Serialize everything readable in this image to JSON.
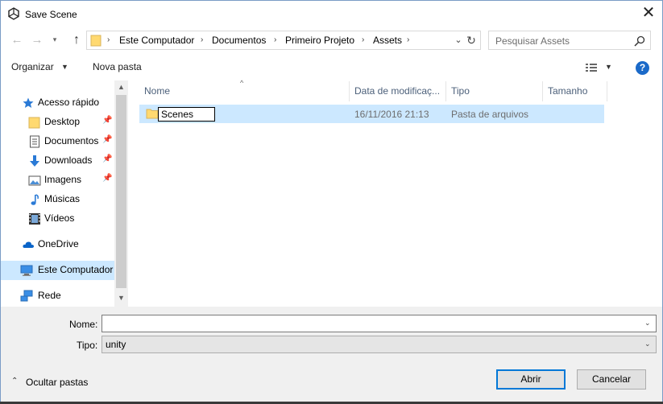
{
  "window": {
    "title": "Save Scene"
  },
  "address": {
    "breadcrumbs": [
      "Este Computador",
      "Documentos",
      "Primeiro Projeto",
      "Assets"
    ],
    "search_placeholder": "Pesquisar Assets"
  },
  "toolbar": {
    "organize_label": "Organizar",
    "new_folder_label": "Nova pasta"
  },
  "sidebar": {
    "items": [
      {
        "label": "Acesso rápido",
        "icon": "star-icon"
      },
      {
        "label": "Desktop",
        "icon": "folder-icon",
        "pinned": true
      },
      {
        "label": "Documentos",
        "icon": "document-icon",
        "pinned": true
      },
      {
        "label": "Downloads",
        "icon": "download-icon",
        "pinned": true
      },
      {
        "label": "Imagens",
        "icon": "image-icon",
        "pinned": true
      },
      {
        "label": "Músicas",
        "icon": "music-icon"
      },
      {
        "label": "Vídeos",
        "icon": "video-icon"
      },
      {
        "label": "OneDrive",
        "icon": "cloud-icon"
      },
      {
        "label": "Este Computador",
        "icon": "computer-icon",
        "selected": true
      },
      {
        "label": "Rede",
        "icon": "network-icon"
      }
    ]
  },
  "columns": [
    "Nome",
    "Data de modificaç...",
    "Tipo",
    "Tamanho"
  ],
  "files": [
    {
      "name": "Scenes",
      "modified": "16/11/2016 21:13",
      "type": "Pasta de arquivos",
      "size": ""
    }
  ],
  "form": {
    "name_label": "Nome:",
    "name_value": "",
    "type_label": "Tipo:",
    "type_value": "unity"
  },
  "footer": {
    "hide_folders_label": "Ocultar pastas",
    "open_label": "Abrir",
    "cancel_label": "Cancelar"
  },
  "colors": {
    "selection": "#cce8ff",
    "accent": "#0078d7",
    "header_text": "#4c607a"
  }
}
